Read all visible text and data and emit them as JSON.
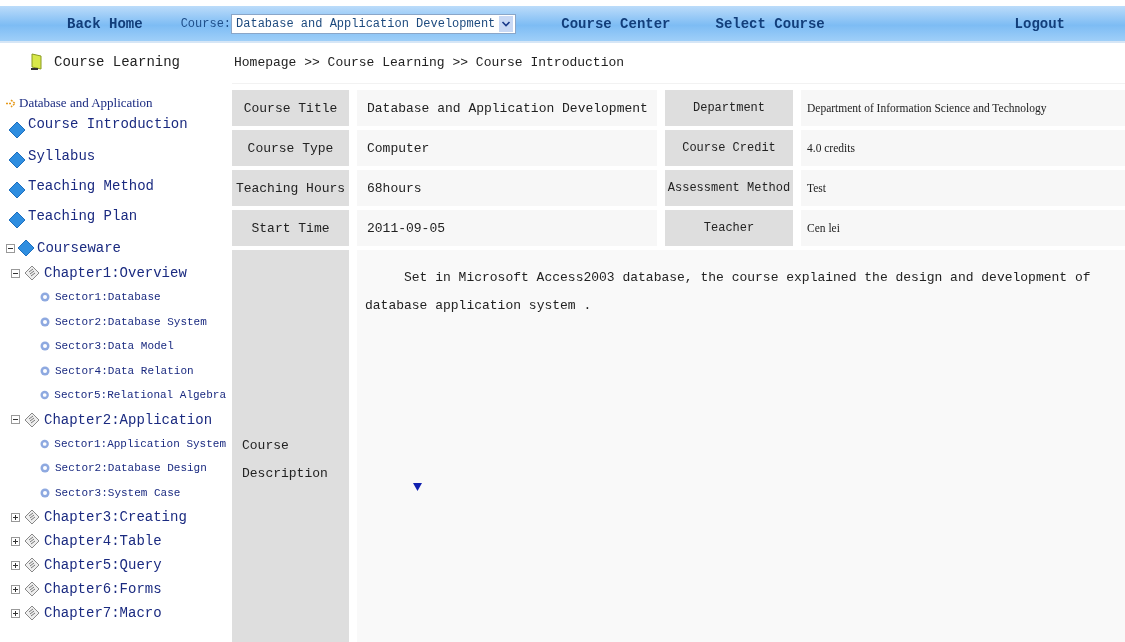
{
  "nav": {
    "back_home": "Back Home",
    "course_label": "Course:",
    "course_value": "Database and Application Development",
    "links": [
      "Course Center",
      "Select Course"
    ],
    "logout": "Logout"
  },
  "sidebar": {
    "header": "Course Learning",
    "tree": [
      {
        "kind": "root",
        "label": "Database and Application",
        "children": [
          {
            "kind": "page",
            "label": "Course Introduction"
          },
          {
            "kind": "page",
            "label": "Syllabus"
          },
          {
            "kind": "page",
            "label": "Teaching Method"
          },
          {
            "kind": "page",
            "label": "Teaching Plan"
          },
          {
            "kind": "folder",
            "label": "Courseware",
            "expanded": true,
            "children": [
              {
                "kind": "chapter",
                "label": "Chapter1:Overview",
                "expanded": true,
                "children": [
                  {
                    "kind": "sector",
                    "label": "Sector1:Database"
                  },
                  {
                    "kind": "sector",
                    "label": "Sector2:Database System"
                  },
                  {
                    "kind": "sector",
                    "label": "Sector3:Data Model"
                  },
                  {
                    "kind": "sector",
                    "label": "Sector4:Data Relation"
                  },
                  {
                    "kind": "sector",
                    "label": "Sector5:Relational Algebra"
                  }
                ]
              },
              {
                "kind": "chapter",
                "label": "Chapter2:Application",
                "expanded": true,
                "children": [
                  {
                    "kind": "sector",
                    "label": "Sector1:Application System"
                  },
                  {
                    "kind": "sector",
                    "label": "Sector2:Database Design"
                  },
                  {
                    "kind": "sector",
                    "label": "Sector3:System Case"
                  }
                ]
              },
              {
                "kind": "chapter",
                "label": "Chapter3:Creating",
                "expanded": false
              },
              {
                "kind": "chapter",
                "label": "Chapter4:Table",
                "expanded": false
              },
              {
                "kind": "chapter",
                "label": "Chapter5:Query",
                "expanded": false
              },
              {
                "kind": "chapter",
                "label": "Chapter6:Forms",
                "expanded": false
              },
              {
                "kind": "chapter",
                "label": "Chapter7:Macro",
                "expanded": false
              }
            ]
          }
        ]
      }
    ]
  },
  "breadcrumb": "Homepage >> Course Learning >> Course Introduction",
  "info_rows": [
    {
      "label": "Course Title",
      "value": "Database and Application Development",
      "label_2": "Department",
      "value_2": "Department of Information Science and Technology"
    },
    {
      "label": "Course Type",
      "value": "Computer",
      "label_2": "Course Credit",
      "value_2": "4.0 credits"
    },
    {
      "label": "Teaching Hours",
      "value": "68hours",
      "label_2": "Assessment Method",
      "value_2": "Test"
    },
    {
      "label": "Start Time",
      "value": "2011-09-05",
      "label_2": "Teacher",
      "value_2": "Cen lei"
    }
  ],
  "description": {
    "label": "Course Description",
    "text": "Set in Microsoft Access2003 database, the course explained the design and development of database application system ."
  }
}
